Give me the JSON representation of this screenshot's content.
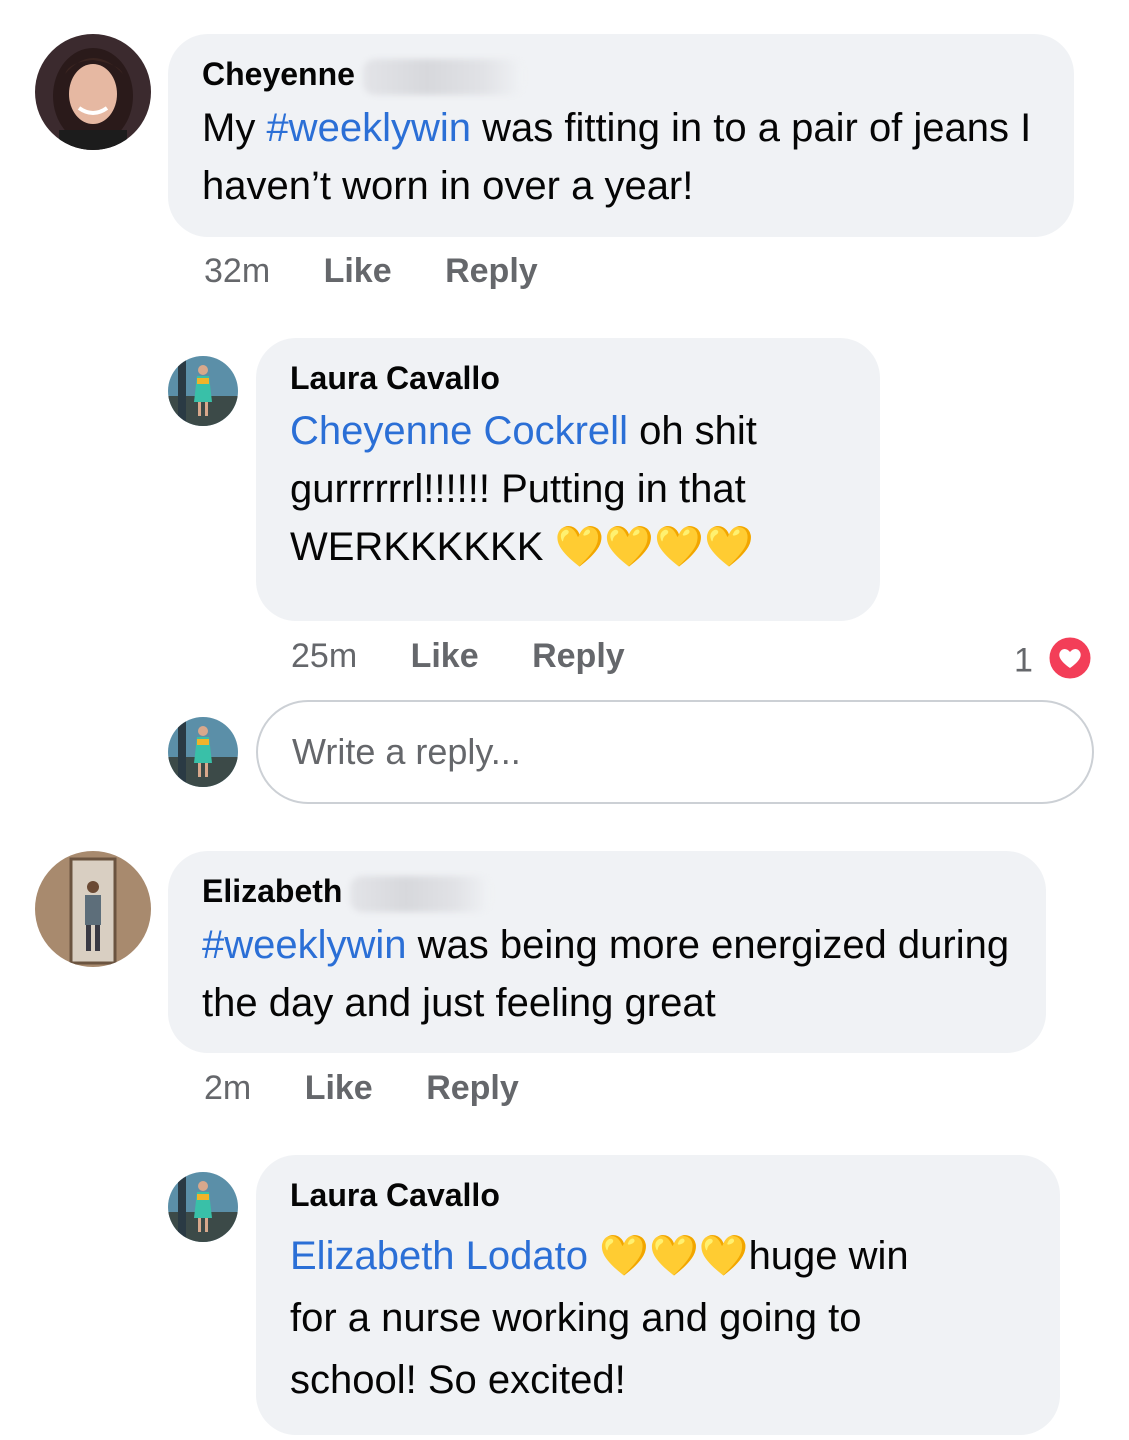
{
  "comments": [
    {
      "author": "Cheyenne",
      "body_hashtag": "#weeklywin",
      "body_prefix": "My ",
      "body_suffix": " was fitting in to a pair of jeans I haven’t worn in over a year!",
      "time": "32m",
      "like": "Like",
      "reply": "Reply"
    },
    {
      "author": "Elizabeth",
      "body_hashtag": "#weeklywin",
      "body_suffix": " was being more energized during the day and just feeling great",
      "time": "2m",
      "like": "Like",
      "reply": "Reply"
    }
  ],
  "replies": [
    {
      "author": "Laura Cavallo",
      "mention": "Cheyenne Cockrell",
      "text_line1": " oh shit",
      "text_line2": "gurrrrrrl!!!!!! Putting in that",
      "text_line3": "WERKKKKKK",
      "emoji": "💛💛💛💛",
      "time": "25m",
      "like": "Like",
      "reply": "Reply",
      "reaction_count": "1"
    },
    {
      "author": "Laura Cavallo",
      "mention": "Elizabeth Lodato",
      "emoji": "💛💛💛",
      "text_after_emoji": "huge win",
      "text_line2": "for a nurse working and going to",
      "text_line3": "school! So excited!"
    }
  ],
  "reply_input": {
    "placeholder": "Write a reply..."
  },
  "colors": {
    "bubble": "#f0f2f5",
    "mention": "#2b6fd6",
    "muted": "#65676b",
    "heart": "#f33e58"
  }
}
